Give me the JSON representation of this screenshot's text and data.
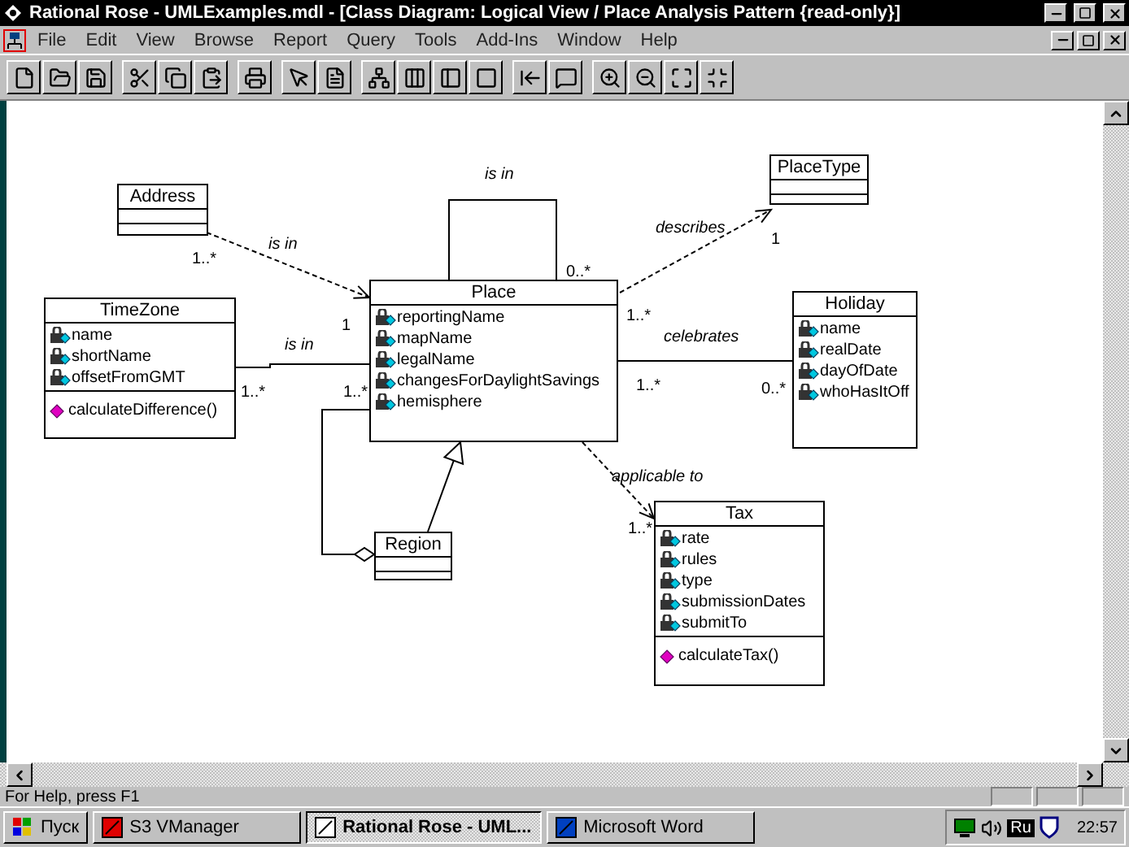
{
  "window": {
    "title": "Rational Rose - UMLExamples.mdl - [Class Diagram: Logical View / Place Analysis Pattern {read-only}]"
  },
  "menu": [
    "File",
    "Edit",
    "View",
    "Browse",
    "Report",
    "Query",
    "Tools",
    "Add-Ins",
    "Window",
    "Help"
  ],
  "diagram": {
    "classes": [
      {
        "name": "Place",
        "attributes": [
          "reportingName",
          "mapName",
          "legalName",
          "changesForDaylightSavings",
          "hemisphere"
        ]
      },
      {
        "name": "Address"
      },
      {
        "name": "TimeZone",
        "attributes": [
          "name",
          "shortName",
          "offsetFromGMT"
        ],
        "operations": [
          "calculateDifference()"
        ]
      },
      {
        "name": "PlaceType"
      },
      {
        "name": "Holiday",
        "attributes": [
          "name",
          "realDate",
          "dayOfDate",
          "whoHasItOff"
        ]
      },
      {
        "name": "Region"
      },
      {
        "name": "Tax",
        "attributes": [
          "rate",
          "rules",
          "type",
          "submissionDates",
          "submitTo"
        ],
        "operations": [
          "calculateTax()"
        ]
      }
    ],
    "relations": [
      {
        "kind": "association",
        "label": "is in",
        "multiplicities": [
          "0..*"
        ]
      },
      {
        "kind": "dependency",
        "label": "is in",
        "multiplicities": [
          "1..*",
          "1"
        ]
      },
      {
        "kind": "association",
        "label": "is in",
        "multiplicities": [
          "1..*",
          "1..*"
        ]
      },
      {
        "kind": "dependency",
        "label": "describes",
        "multiplicities": [
          "1",
          "1..*"
        ]
      },
      {
        "kind": "association",
        "label": "celebrates",
        "multiplicities": [
          "1..*",
          "0..*"
        ]
      },
      {
        "kind": "dependency",
        "label": "applicable to",
        "multiplicities": [
          "1..*"
        ]
      },
      {
        "kind": "generalization"
      },
      {
        "kind": "aggregation"
      }
    ]
  },
  "status_bar": "For Help, press F1",
  "taskbar": {
    "start": "Пуск",
    "tasks": [
      {
        "label": "S3 VManager",
        "selected": false
      },
      {
        "label": "Rational Rose - UML...",
        "selected": true
      },
      {
        "label": "Microsoft Word",
        "selected": false
      }
    ],
    "language": "Ru",
    "clock": "22:57"
  }
}
